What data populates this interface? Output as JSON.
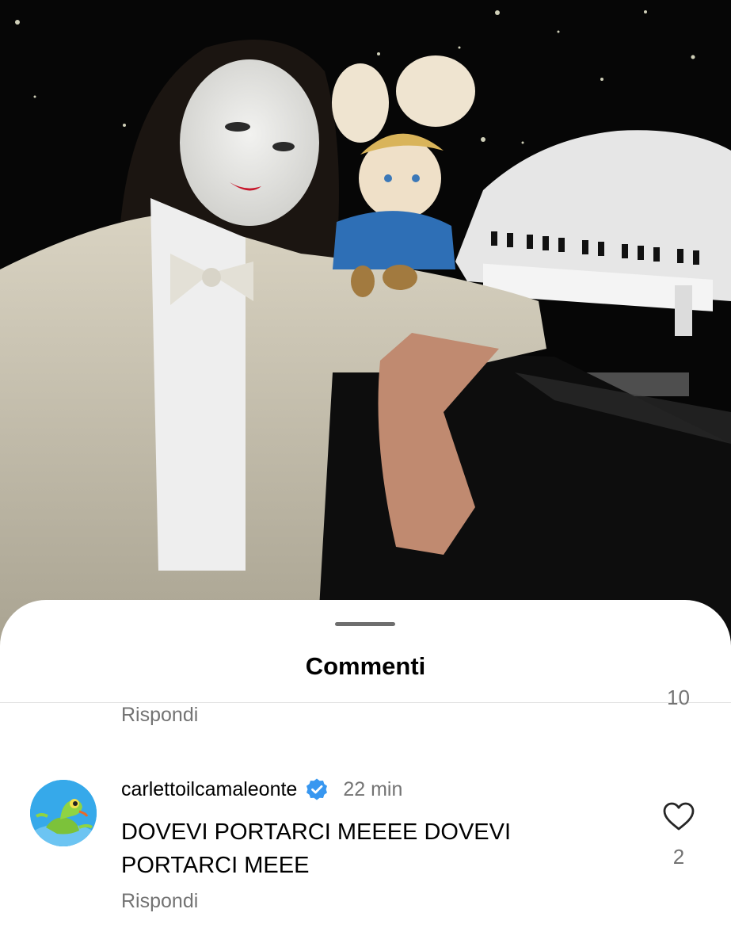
{
  "photo": {
    "alt_icon": "post-image"
  },
  "sheet": {
    "title": "Commenti"
  },
  "previous_comment": {
    "reply_label": "Rispondi",
    "likes": "10"
  },
  "comment": {
    "username": "carlettoilcamaleonte",
    "time": "22 min",
    "text": "DOVEVI PORTARCI MEEEE DOVEVI PORTARCI MEEE",
    "reply_label": "Rispondi",
    "likes": "2"
  },
  "colors": {
    "verified": "#3897f0",
    "secondary_text": "#737373"
  }
}
